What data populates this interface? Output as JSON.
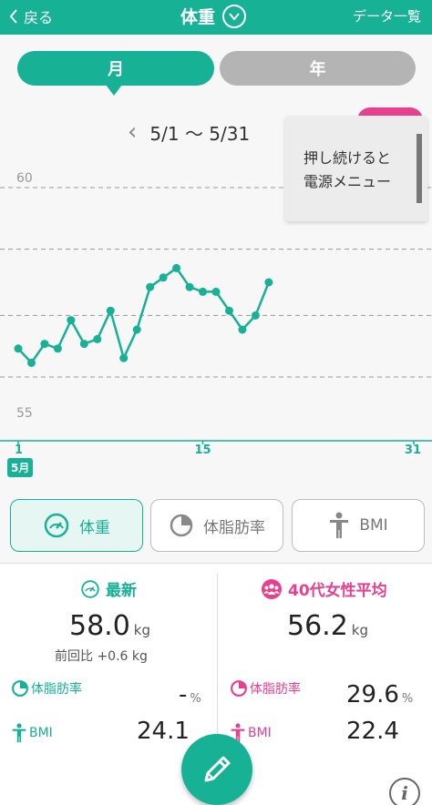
{
  "topbar": {
    "back_label": "戻る",
    "title": "体重",
    "list_label": "データ一覧"
  },
  "tabs": {
    "month": "月",
    "year": "年"
  },
  "range": {
    "label": "5/1 〜 5/31"
  },
  "tooltip": {
    "line1": "押し続けると",
    "line2": "電源メニュー"
  },
  "date_badge": "5月",
  "chart_data": {
    "type": "line",
    "x": [
      1,
      2,
      3,
      4,
      5,
      6,
      7,
      8,
      9,
      10,
      11,
      12,
      13,
      14,
      15,
      16,
      17,
      18,
      19,
      20,
      21
    ],
    "series": [
      {
        "values": [
          56.6,
          56.3,
          56.7,
          56.6,
          57.2,
          56.7,
          56.8,
          57.4,
          56.4,
          57.0,
          57.9,
          58.1,
          58.3,
          57.9,
          57.8,
          57.8,
          57.4,
          57.0,
          57.3,
          58.0
        ]
      }
    ],
    "x_ticks": [
      "1",
      "15",
      "31"
    ],
    "y_labels": [
      "60",
      "55"
    ],
    "ylim": [
      55,
      60
    ],
    "xlim": [
      1,
      31
    ],
    "grid": true,
    "color": "#17b196"
  },
  "metrics": {
    "weight": "体重",
    "body_fat": "体脂肪率",
    "bmi": "BMI"
  },
  "latest": {
    "title": "最新",
    "weight": "58.0",
    "unit": "kg",
    "prev_label": "前回比 +0.6 kg",
    "fat_label": "体脂肪率",
    "fat_value": "-",
    "fat_unit": "%",
    "bmi_label": "BMI",
    "bmi_value": "24.1"
  },
  "average": {
    "title": "40代女性平均",
    "weight": "56.2",
    "unit": "kg",
    "fat_label": "体脂肪率",
    "fat_value": "29.6",
    "fat_unit": "%",
    "bmi_label": "BMI",
    "bmi_value": "22.4"
  },
  "colors": {
    "accent": "#17b196",
    "pink": "#e8408e"
  }
}
